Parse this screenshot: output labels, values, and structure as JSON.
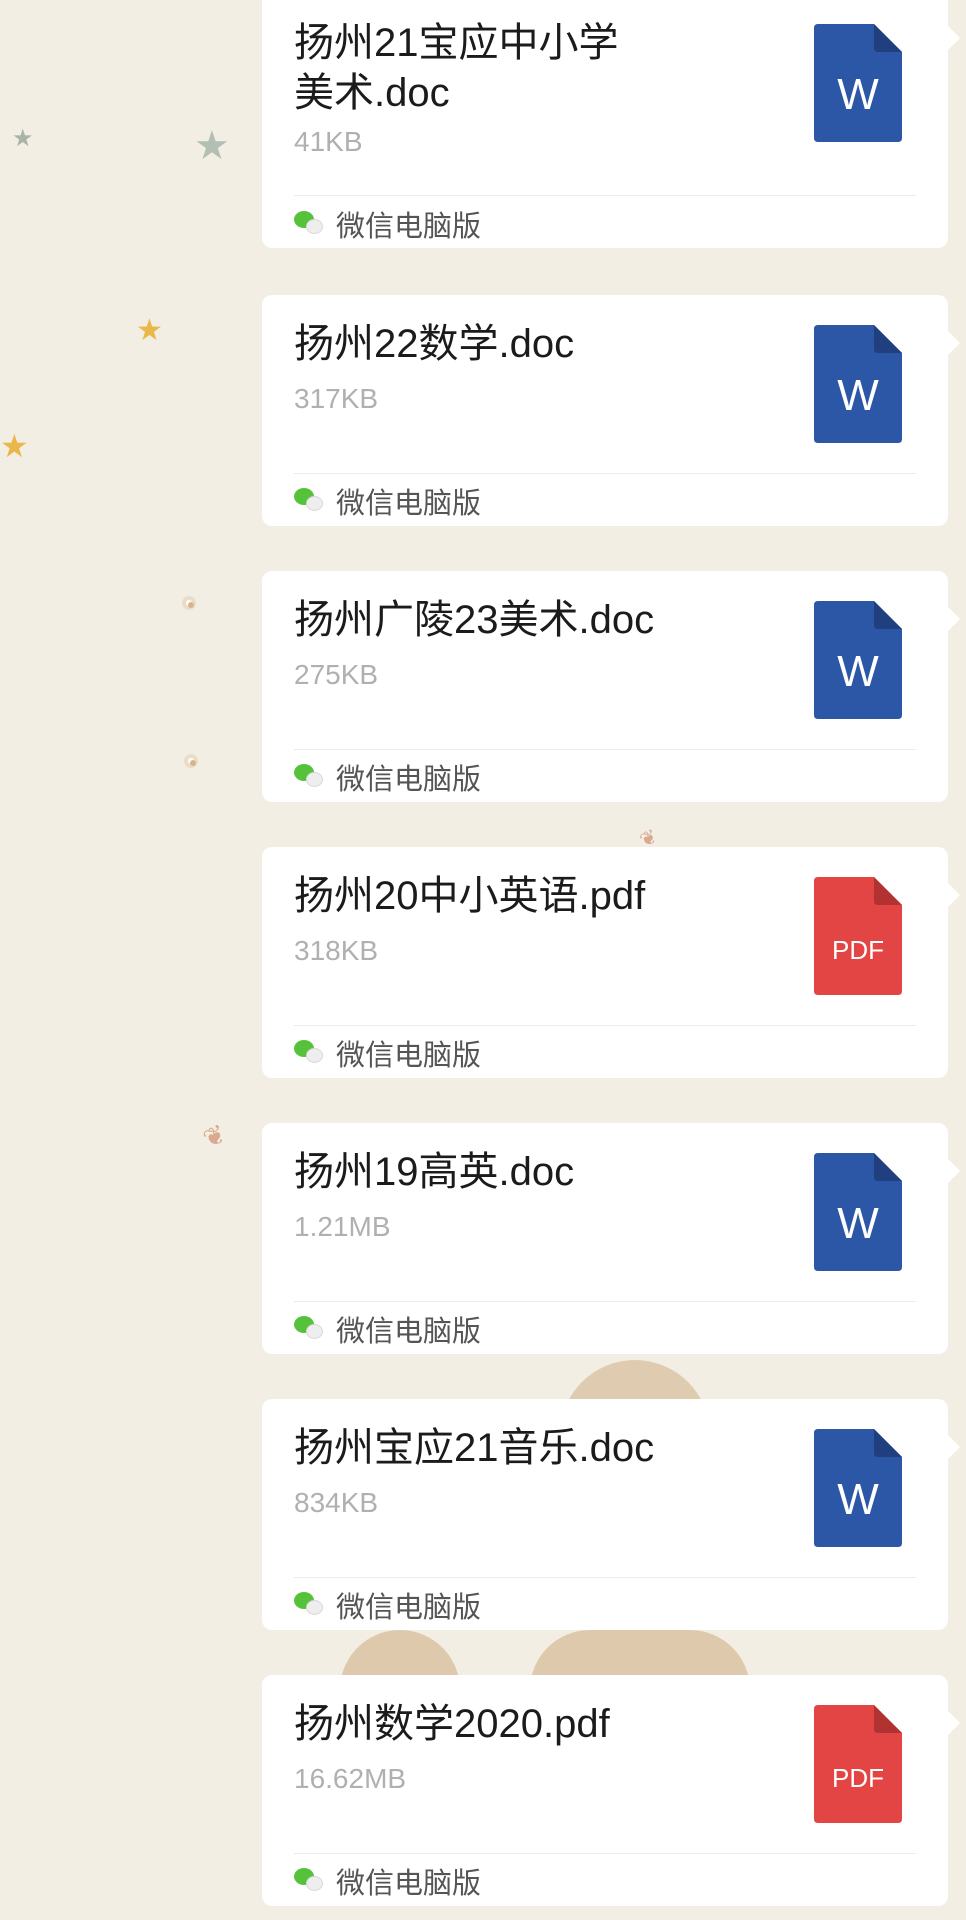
{
  "chat": {
    "messages": [
      {
        "file_name": "扬州21宝应中小学\n美术.doc",
        "size": "41KB",
        "type": "word",
        "icon_letter": "W",
        "source": "微信电脑版"
      },
      {
        "file_name": "扬州22数学.doc",
        "size": "317KB",
        "type": "word",
        "icon_letter": "W",
        "source": "微信电脑版"
      },
      {
        "file_name": "扬州广陵23美术.doc",
        "size": "275KB",
        "type": "word",
        "icon_letter": "W",
        "source": "微信电脑版"
      },
      {
        "file_name": "扬州20中小英语.pdf",
        "size": "318KB",
        "type": "pdf",
        "icon_letter": "PDF",
        "source": "微信电脑版"
      },
      {
        "file_name": "扬州19高英.doc",
        "size": "1.21MB",
        "type": "word",
        "icon_letter": "W",
        "source": "微信电脑版"
      },
      {
        "file_name": "扬州宝应21音乐.doc",
        "size": "834KB",
        "type": "word",
        "icon_letter": "W",
        "source": "微信电脑版"
      },
      {
        "file_name": "扬州数学2020.pdf",
        "size": "16.62MB",
        "type": "pdf",
        "icon_letter": "PDF",
        "source": "微信电脑版"
      }
    ]
  },
  "icons": {
    "word": "word-file-icon",
    "pdf": "pdf-file-icon",
    "source": "wechat-icon"
  },
  "colors": {
    "background": "#f3eee3",
    "word": "#2b57a6",
    "word_fold": "#1f3f7f",
    "pdf": "#e34544",
    "pdf_fold": "#b23232",
    "wechat_green": "#56c23b"
  }
}
